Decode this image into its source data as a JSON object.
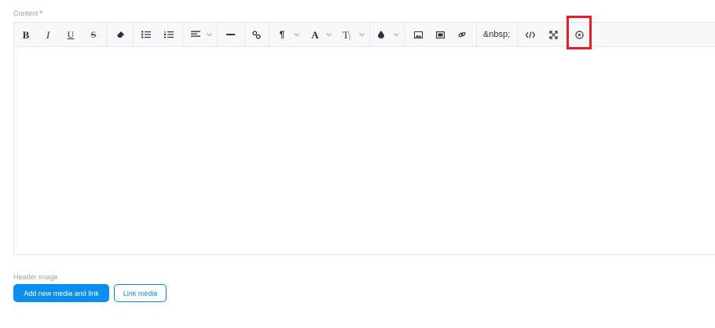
{
  "content_field": {
    "label": "Content",
    "required_mark": "*"
  },
  "toolbar": {
    "bold": "B",
    "italic": "I",
    "underline": "U",
    "strike": "S",
    "paragraph": "¶",
    "font": "A",
    "font_size": "T",
    "nbsp": "&nbsp;"
  },
  "header_image": {
    "label": "Header image",
    "add_button": "Add new media and link",
    "link_button": "Link media"
  },
  "colors": {
    "accent": "#0b8ef2",
    "highlight": "#ea1c24",
    "required": "#e5484d"
  }
}
